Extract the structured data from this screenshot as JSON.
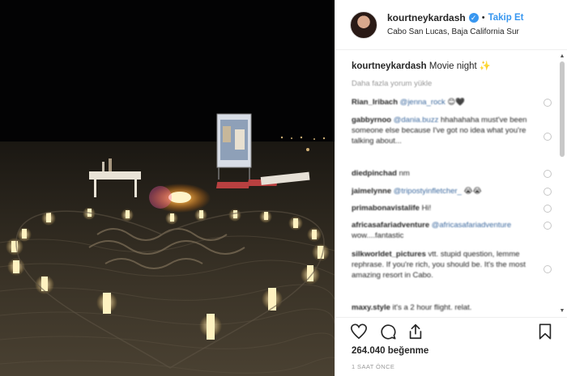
{
  "post": {
    "username": "kourtneykardash",
    "verified_icon": "verified-badge-icon",
    "separator": "•",
    "follow_label": "Takip Et",
    "location": "Cabo San Lucas, Baja California Sur",
    "caption_user": "kourtneykardash",
    "caption_text": "Movie night ✨",
    "load_more": "Daha fazla yorum yükle",
    "likes": "264.040 beğenme",
    "time": "1 SAAT ÖNCE"
  },
  "comments": [
    {
      "user": "Rian_Iribach",
      "mention": "@jenna_rock",
      "text": " 😊🖤"
    },
    {
      "user": "gabbyrnoo",
      "mention": "@dania.buzz",
      "text": " hhahahaha must've been someone else because I've got no idea what you're talking about..."
    },
    {
      "user": "diedpinchad",
      "mention": "",
      "text": " nm"
    },
    {
      "user": "jaimelynne",
      "mention": "@tripostyinfletcher_",
      "text": " 😭😭"
    },
    {
      "user": "primabonavistalife",
      "mention": "",
      "text": " Hi!"
    },
    {
      "user": "africasafariadventure",
      "mention": "@africasafariadventure",
      "text": " wow....fantastic"
    },
    {
      "user": "silkworldet_pictures",
      "mention": "",
      "text": " vtt. stupid question, lemme rephrase. If you're rich, you should be. It's the most amazing resort in Cabo."
    },
    {
      "user": "maxy.style",
      "mention": "",
      "text": " it's a 2 hour flight. relat."
    }
  ],
  "icons": {
    "like": "heart-icon",
    "comment": "comment-icon",
    "share": "share-icon",
    "save": "bookmark-icon"
  },
  "colors": {
    "accent": "#3897f0",
    "text": "#262626",
    "muted": "#999999"
  }
}
